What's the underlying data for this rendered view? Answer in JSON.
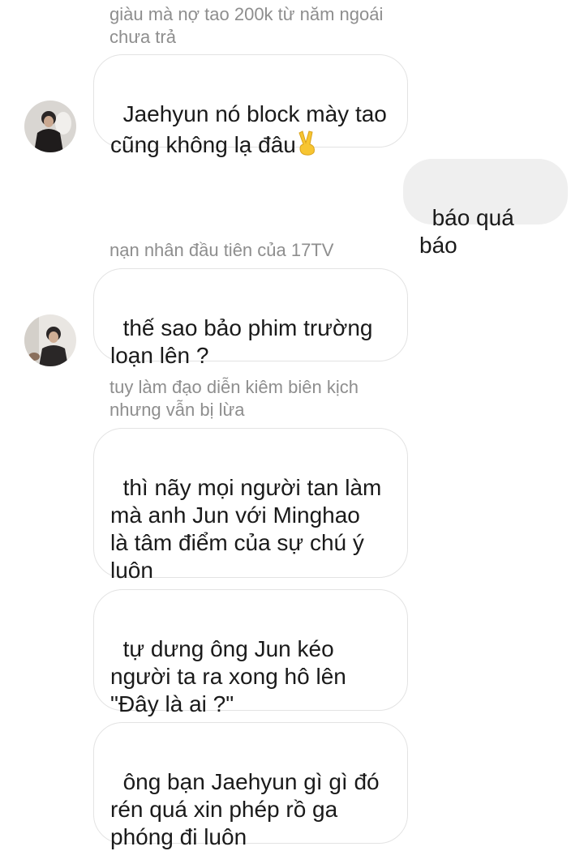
{
  "messages": [
    {
      "sender": "giàu mà nợ tao 200k từ năm ngoái\nchưa trả",
      "text": "Jaehyun nó block mày tao\ncũng không lạ đâu",
      "emoji": "✌"
    },
    {
      "text": "báo quá báo"
    },
    {
      "sender": "nạn nhân đầu tiên của 17TV",
      "text": "thế sao bảo phim trường\nloạn lên ?"
    },
    {
      "sender": "tuy làm đạo diễn kiêm biên kịch\nnhưng vẫn bị lừa",
      "text": "thì nãy mọi người tan làm\nmà anh Jun với Minghao\nlà tâm điểm của sự chú ý\nluôn"
    },
    {
      "text": "tự dưng ông Jun kéo\nngười ta ra xong hô lên\n\"Đây là ai ?\""
    },
    {
      "text": "ông bạn Jaehyun gì gì đó\nrén quá xin phép rồ ga\nphóng đi luôn"
    }
  ],
  "colors": {
    "sender_name": "#8e8e8e",
    "bubble_border": "#e3e3e3",
    "outgoing_bubble": "#efefef",
    "emoji": "#f7c531"
  }
}
